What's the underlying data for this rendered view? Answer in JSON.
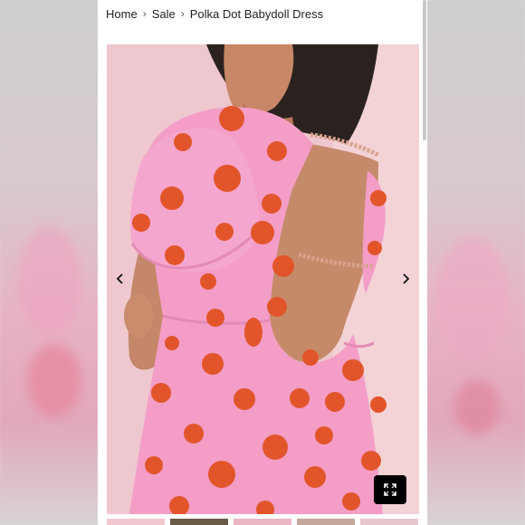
{
  "breadcrumb": {
    "home": "Home",
    "sale": "Sale",
    "current": "Polka Dot Babydoll Dress"
  },
  "gallery": {
    "image_alt": "Polka dot babydoll dress, back view",
    "prev_icon": "chevron-left-icon",
    "next_icon": "chevron-right-icon",
    "zoom_icon": "expand-icon"
  },
  "thumbnails": [
    {
      "color": "#f2c7d0"
    },
    {
      "color": "#6b5a45"
    },
    {
      "color": "#e9b8c4"
    },
    {
      "color": "#c4a89c"
    },
    {
      "color": "#e8c6cd"
    }
  ],
  "colors": {
    "dress_pink": "#f39cc6",
    "dot_orange": "#e2552a",
    "background_pink": "#f0c8cf",
    "skin": "#c98c6c"
  }
}
